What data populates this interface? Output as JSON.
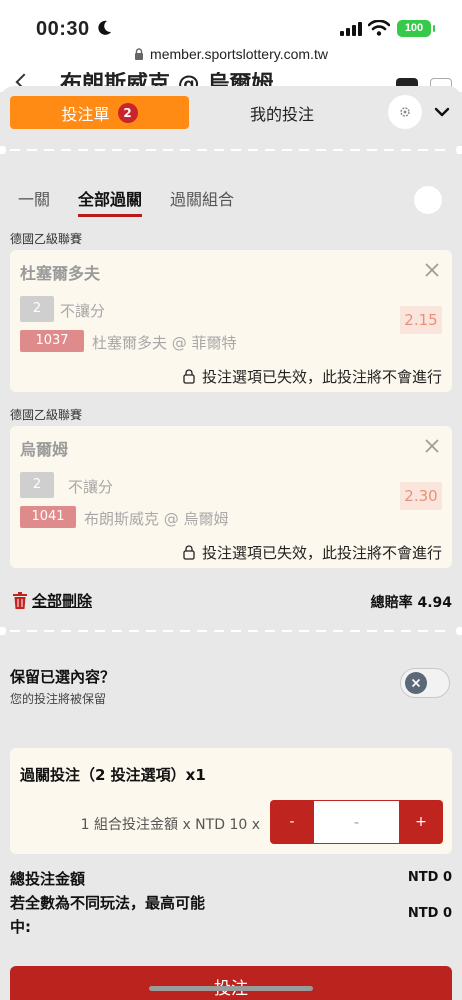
{
  "status_bar": {
    "time": "00:30",
    "battery": "100"
  },
  "browser": {
    "url": "member.sportslottery.com.tw"
  },
  "background": {
    "title": "布朗斯威克 @ 烏爾姆"
  },
  "header": {
    "bet_slip_tab": "投注單",
    "bet_slip_count": "2",
    "my_bets_tab": "我的投注"
  },
  "subtabs": [
    {
      "label": "一關",
      "active": false
    },
    {
      "label": "全部過關",
      "active": true
    },
    {
      "label": "過關組合",
      "active": false
    }
  ],
  "bets": [
    {
      "league": "德國乙級聯賽",
      "team": "杜塞爾多夫",
      "option_num": "2",
      "market": "不讓分",
      "code": "1037",
      "match": "杜塞爾多夫 @ 菲爾特",
      "odds": "2.15",
      "notice": "投注選項已失效，此投注將不會進行"
    },
    {
      "league": "德國乙級聯賽",
      "team": "烏爾姆",
      "option_num": "2",
      "market": "不讓分",
      "code": "1041",
      "match": "布朗斯威克 @ 烏爾姆",
      "odds": "2.30",
      "notice": "投注選項已失效，此投注將不會進行"
    }
  ],
  "actions": {
    "delete_all": "全部刪除",
    "total_odds_label": "總賠率",
    "total_odds": "4.94"
  },
  "keep": {
    "title": "保留已選內容？",
    "subtitle": "您的投注將被保留",
    "enabled": false
  },
  "parlay": {
    "title": "過關投注（2 投注選項）x1",
    "amount_line": "1 組合投注金額 x NTD 10 x",
    "minus": "-",
    "value": "-",
    "plus": "+"
  },
  "summary": {
    "total_label": "總投注金額",
    "total_value": "NTD 0",
    "max_label_1": "若全數為不同玩法，最高可能",
    "max_label_2": "中:",
    "max_value": "NTD 0"
  },
  "submit_label": "投注",
  "colors": {
    "accent": "#ff8a14",
    "danger": "#c0241f",
    "card_bg": "#fdf8ee"
  }
}
